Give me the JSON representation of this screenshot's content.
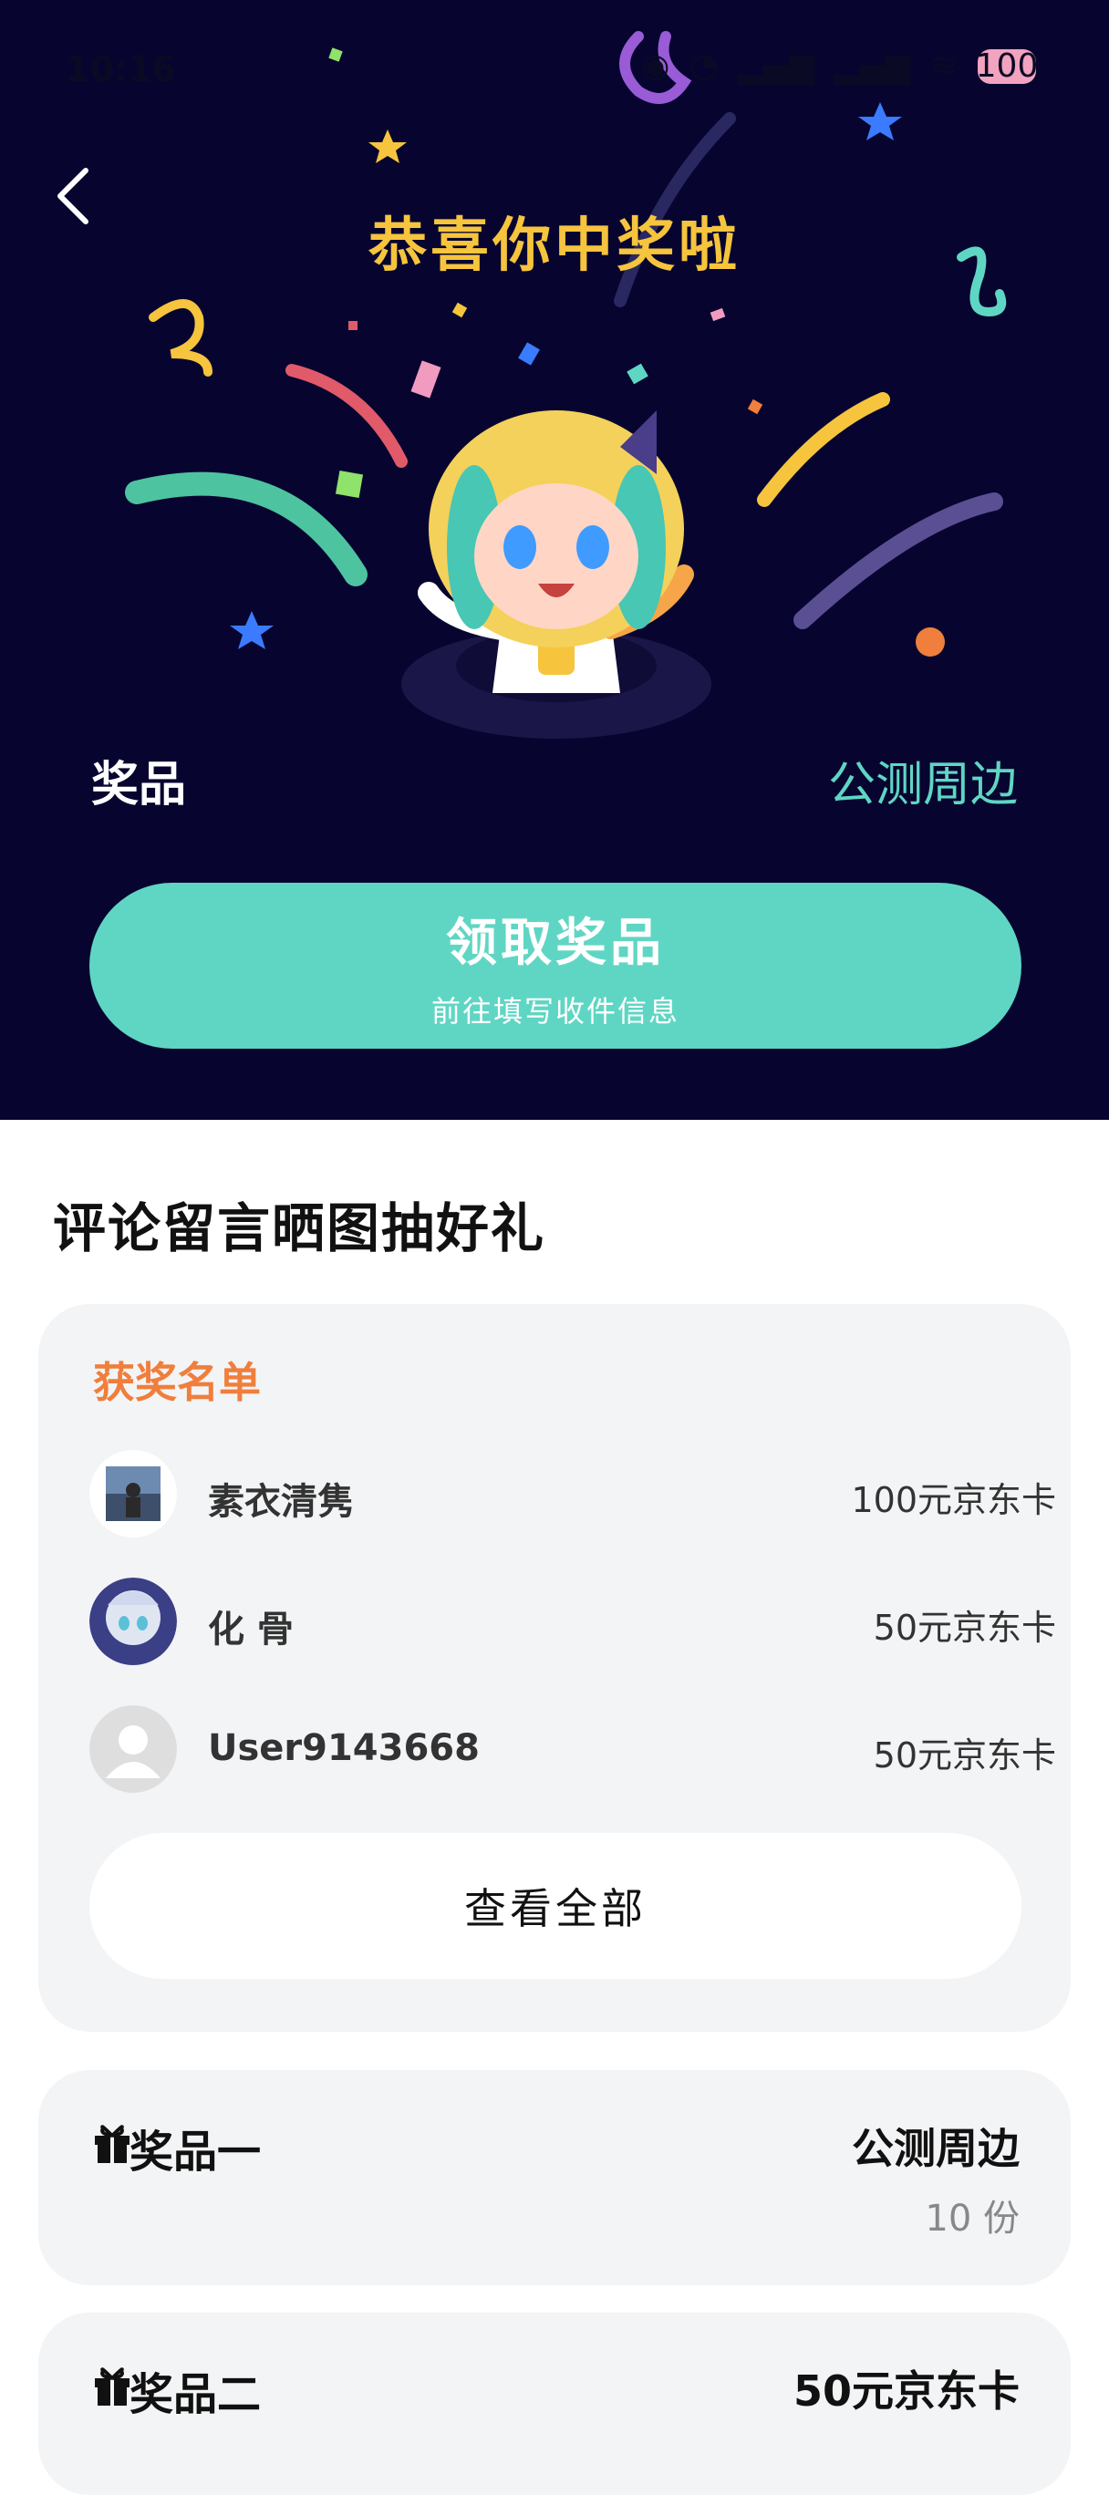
{
  "status_bar": {
    "time": "10:16",
    "icons": [
      "nfc-icon",
      "alarm-icon",
      "signal-1-icon",
      "signal-2-icon",
      "wifi-icon"
    ],
    "battery": "100"
  },
  "hero": {
    "title": "恭喜你中奖啦",
    "prize_label": "奖品",
    "prize_value": "公测周边",
    "claim_button": {
      "label": "领取奖品",
      "sublabel": "前往填写收件信息"
    }
  },
  "section": {
    "title": "评论留言晒图抽好礼"
  },
  "winners": {
    "title": "获奖名单",
    "items": [
      {
        "name": "素衣清隽",
        "prize": "100元京东卡"
      },
      {
        "name": "化 骨",
        "prize": "50元京东卡"
      },
      {
        "name": "User9143668",
        "prize": "50元京东卡"
      }
    ],
    "view_all": "查看全部"
  },
  "prizes": [
    {
      "label": "奖品一",
      "name": "公测周边",
      "count": "10 份"
    },
    {
      "label": "奖品二",
      "name": "50元京东卡",
      "count": ""
    }
  ],
  "colors": {
    "hero_bg": "#070530",
    "title_gold": "#f6c43d",
    "accent_teal": "#5fd6c3",
    "winners_orange": "#f07e3c",
    "card_bg": "#f3f4f6"
  }
}
